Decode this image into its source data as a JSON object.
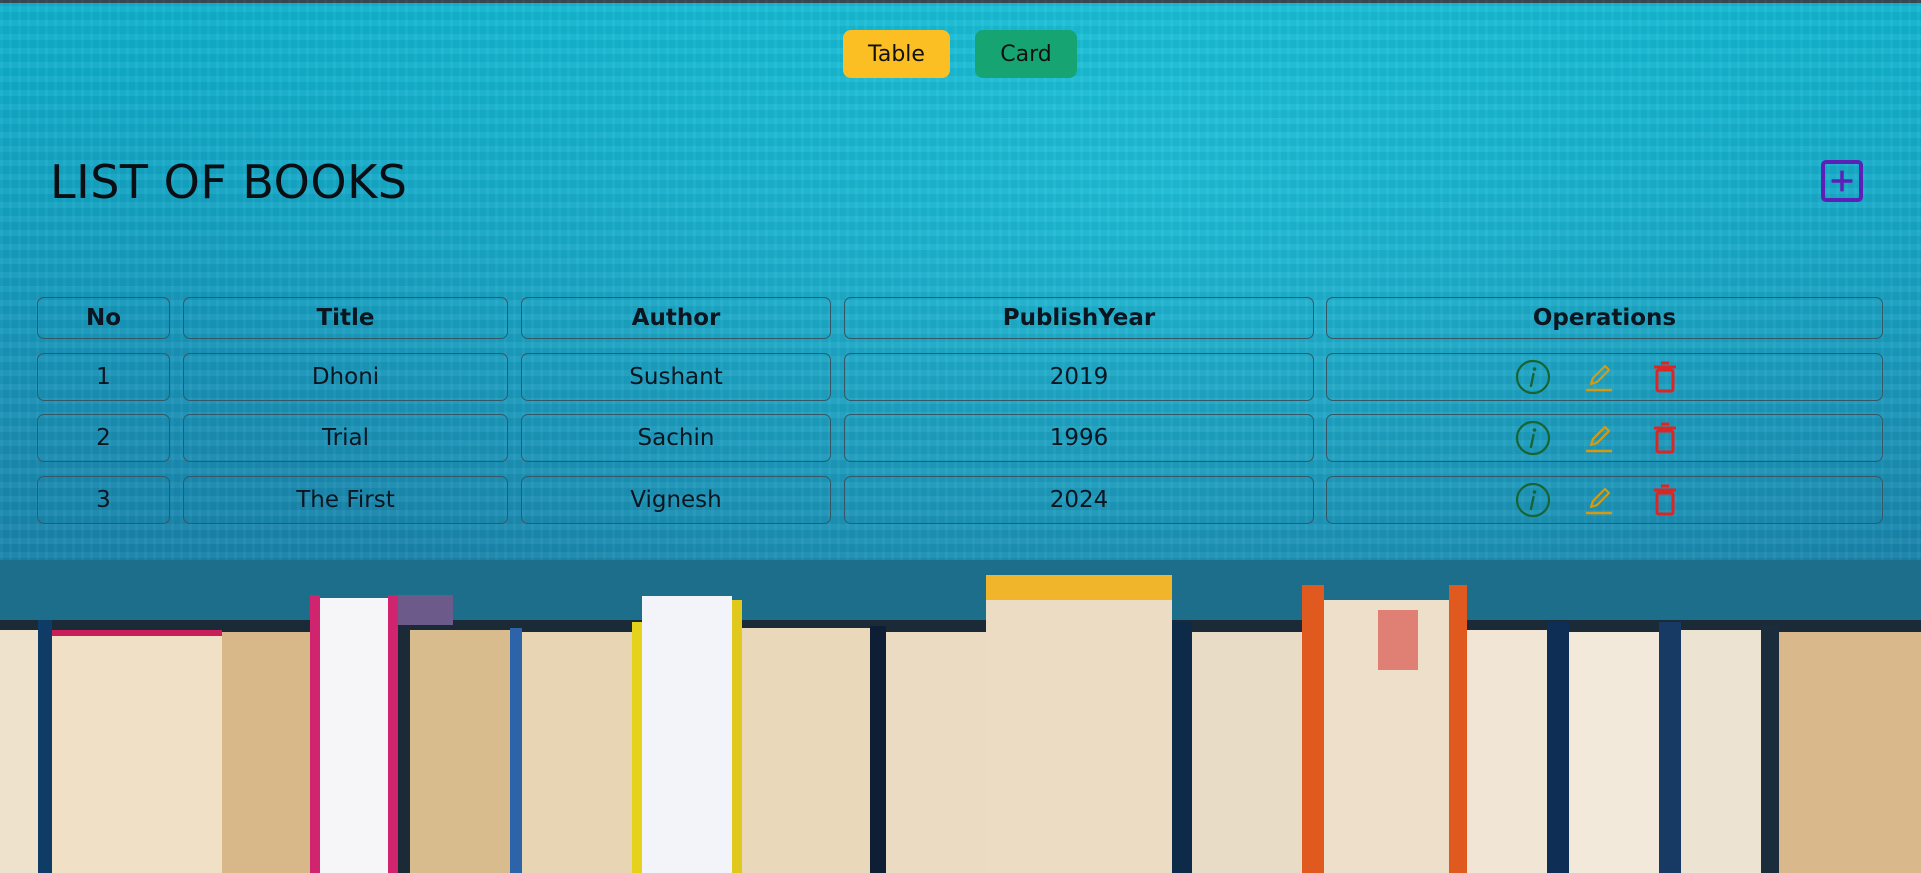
{
  "view_toggle": {
    "table_label": "Table",
    "card_label": "Card"
  },
  "page": {
    "title": "LIST OF BOOKS"
  },
  "table": {
    "headers": {
      "no": "No",
      "title": "Title",
      "author": "Author",
      "year": "PublishYear",
      "ops": "Operations"
    },
    "rows": [
      {
        "no": "1",
        "title": "Dhoni",
        "author": "Sushant",
        "year": "2019"
      },
      {
        "no": "2",
        "title": "Trial",
        "author": "Sachin",
        "year": "1996"
      },
      {
        "no": "3",
        "title": "The First",
        "author": "Vignesh",
        "year": "2024"
      }
    ],
    "operations": [
      "info-icon",
      "edit-pencil-icon",
      "delete-trash-icon"
    ]
  },
  "colors": {
    "table_button": "#fbbf24",
    "card_button": "#16a572",
    "add_button": "#5b21b6",
    "info": "#166534",
    "edit": "#d49b12",
    "delete": "#dc2626"
  },
  "icons": {
    "add": "plus-square-icon"
  }
}
